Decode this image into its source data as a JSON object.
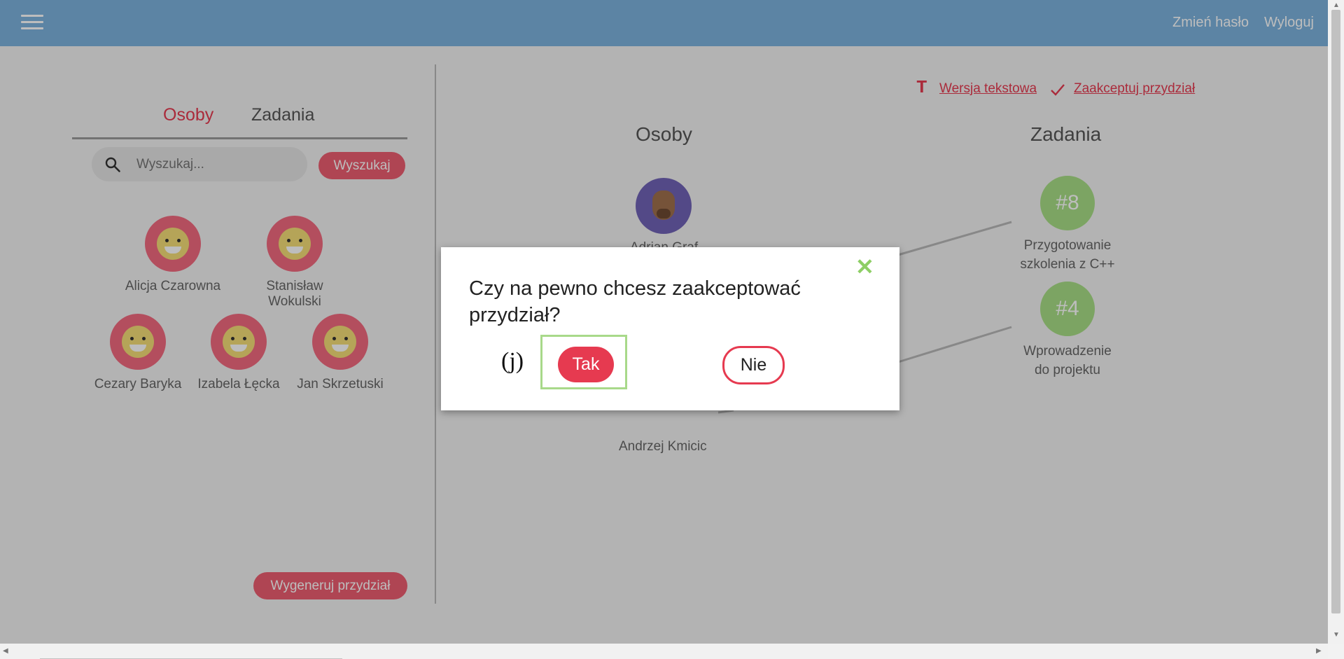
{
  "header": {
    "menu_icon": "hamburger-icon",
    "change_password": "Zmień hasło",
    "logout": "Wyloguj"
  },
  "left": {
    "tabs": [
      {
        "label": "Osoby",
        "active": true
      },
      {
        "label": "Zadania",
        "active": false
      }
    ],
    "search": {
      "placeholder": "Wyszukaj...",
      "button": "Wyszukaj",
      "icon": "search-icon"
    },
    "people": [
      {
        "name": "Alicja Czarowna"
      },
      {
        "name": "Stanisław Wokulski"
      },
      {
        "name": "Cezary Baryka"
      },
      {
        "name": "Izabela Łęcka"
      },
      {
        "name": "Jan Skrzetuski"
      }
    ],
    "generate_button": "Wygeneruj przydział"
  },
  "right": {
    "text_version_icon": "T",
    "text_version": "Wersja tekstowa",
    "accept_icon": "checkmark-icon",
    "accept": "Zaakceptuj przydział",
    "col_people": "Osoby",
    "col_tasks": "Zadania",
    "assigned_people": [
      {
        "name": "Adrian Grąf",
        "avatar": "capybara-avatar"
      },
      {
        "name": "Andrzej Kmicic",
        "avatar": "green-avatar"
      }
    ],
    "tasks": [
      {
        "number": "#8",
        "line1": "Przygotowanie",
        "line2": "szkolenia z C++"
      },
      {
        "number": "#4",
        "line1": "Wprowadzenie",
        "line2": "do projektu"
      }
    ]
  },
  "modal": {
    "message": "Czy na pewno chcesz zaakceptować przydział?",
    "hint": "(j)",
    "yes": "Tak",
    "no": "Nie",
    "close_icon": "close-icon"
  },
  "colors": {
    "header": "#7cb2de",
    "accent": "#e63a50",
    "task_green": "#a8dd86",
    "person_pink": "#f26a7f"
  }
}
